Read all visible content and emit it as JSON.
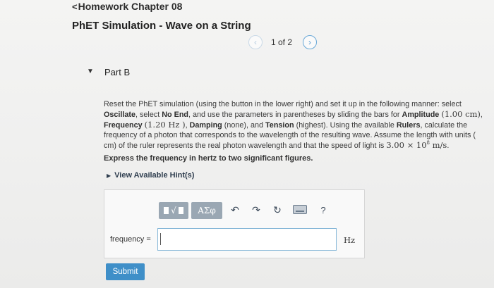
{
  "header": {
    "back_label": "Homework Chapter 08",
    "back_chevron": "<",
    "page_title": "PhET Simulation - Wave on a String"
  },
  "pager": {
    "prev_icon": "‹",
    "next_icon": "›",
    "text": "1 of 2"
  },
  "part": {
    "toggle_icon": "▼",
    "title": "Part B"
  },
  "question": {
    "s1": "Reset the PhET simulation (using the button in the lower right) and set it up in the following manner: select ",
    "oscillate": "Oscillate",
    "s2": ", select ",
    "no_end": "No End",
    "s3": ", and use the parameters in parentheses by sliding the bars for ",
    "amplitude": "Amplitude",
    "amp_val": "(1.00 cm)",
    "s4": ", ",
    "frequency": "Frequency",
    "freq_val": "(1.20 Hz )",
    "s5": ", ",
    "damping": "Damping",
    "damp_val": " (none), and ",
    "tension": "Tension",
    "tension_val": " (highest). Using the available ",
    "rulers": "Rulers",
    "s6": ", calculate the frequency of a photon that corresponds to the wavelength of the resulting wave. Assume the length with units ( cm) of the ruler represents the real photon wavelength and that the speed of light is ",
    "c_mantissa": "3.00 × 10",
    "c_exp": "8",
    "c_unit": " m/s",
    "s7": "."
  },
  "instruction": "Express the frequency in hertz to two significant figures.",
  "hint": {
    "icon": "▶",
    "label": "View Available Hint(s)"
  },
  "toolbar": {
    "templates_radical": "√",
    "symbols_label": "ΑΣφ",
    "undo_icon": "↶",
    "redo_icon": "↷",
    "reset_icon": "↻",
    "help_icon": "?"
  },
  "answer": {
    "label": "frequency =",
    "value": "",
    "unit": "Hz"
  },
  "submit_label": "Submit"
}
